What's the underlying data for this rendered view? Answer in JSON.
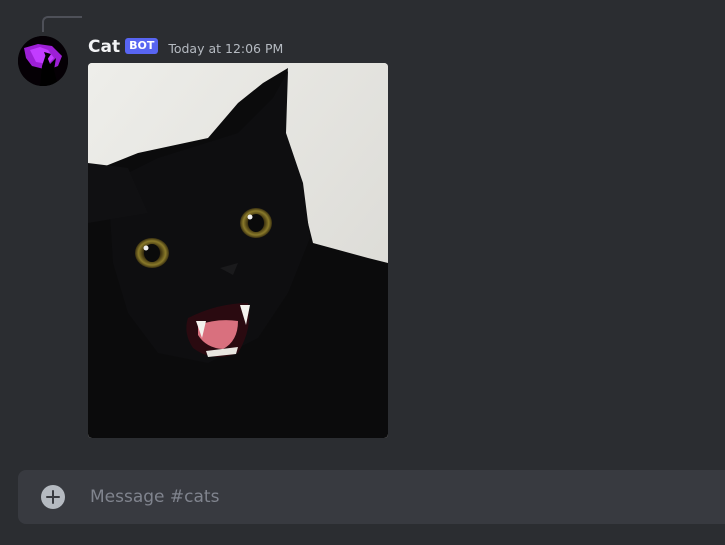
{
  "message": {
    "author": "Cat",
    "badge": "BOT",
    "timestamp": "Today at 12:06 PM"
  },
  "composer": {
    "placeholder": "Message #cats"
  }
}
